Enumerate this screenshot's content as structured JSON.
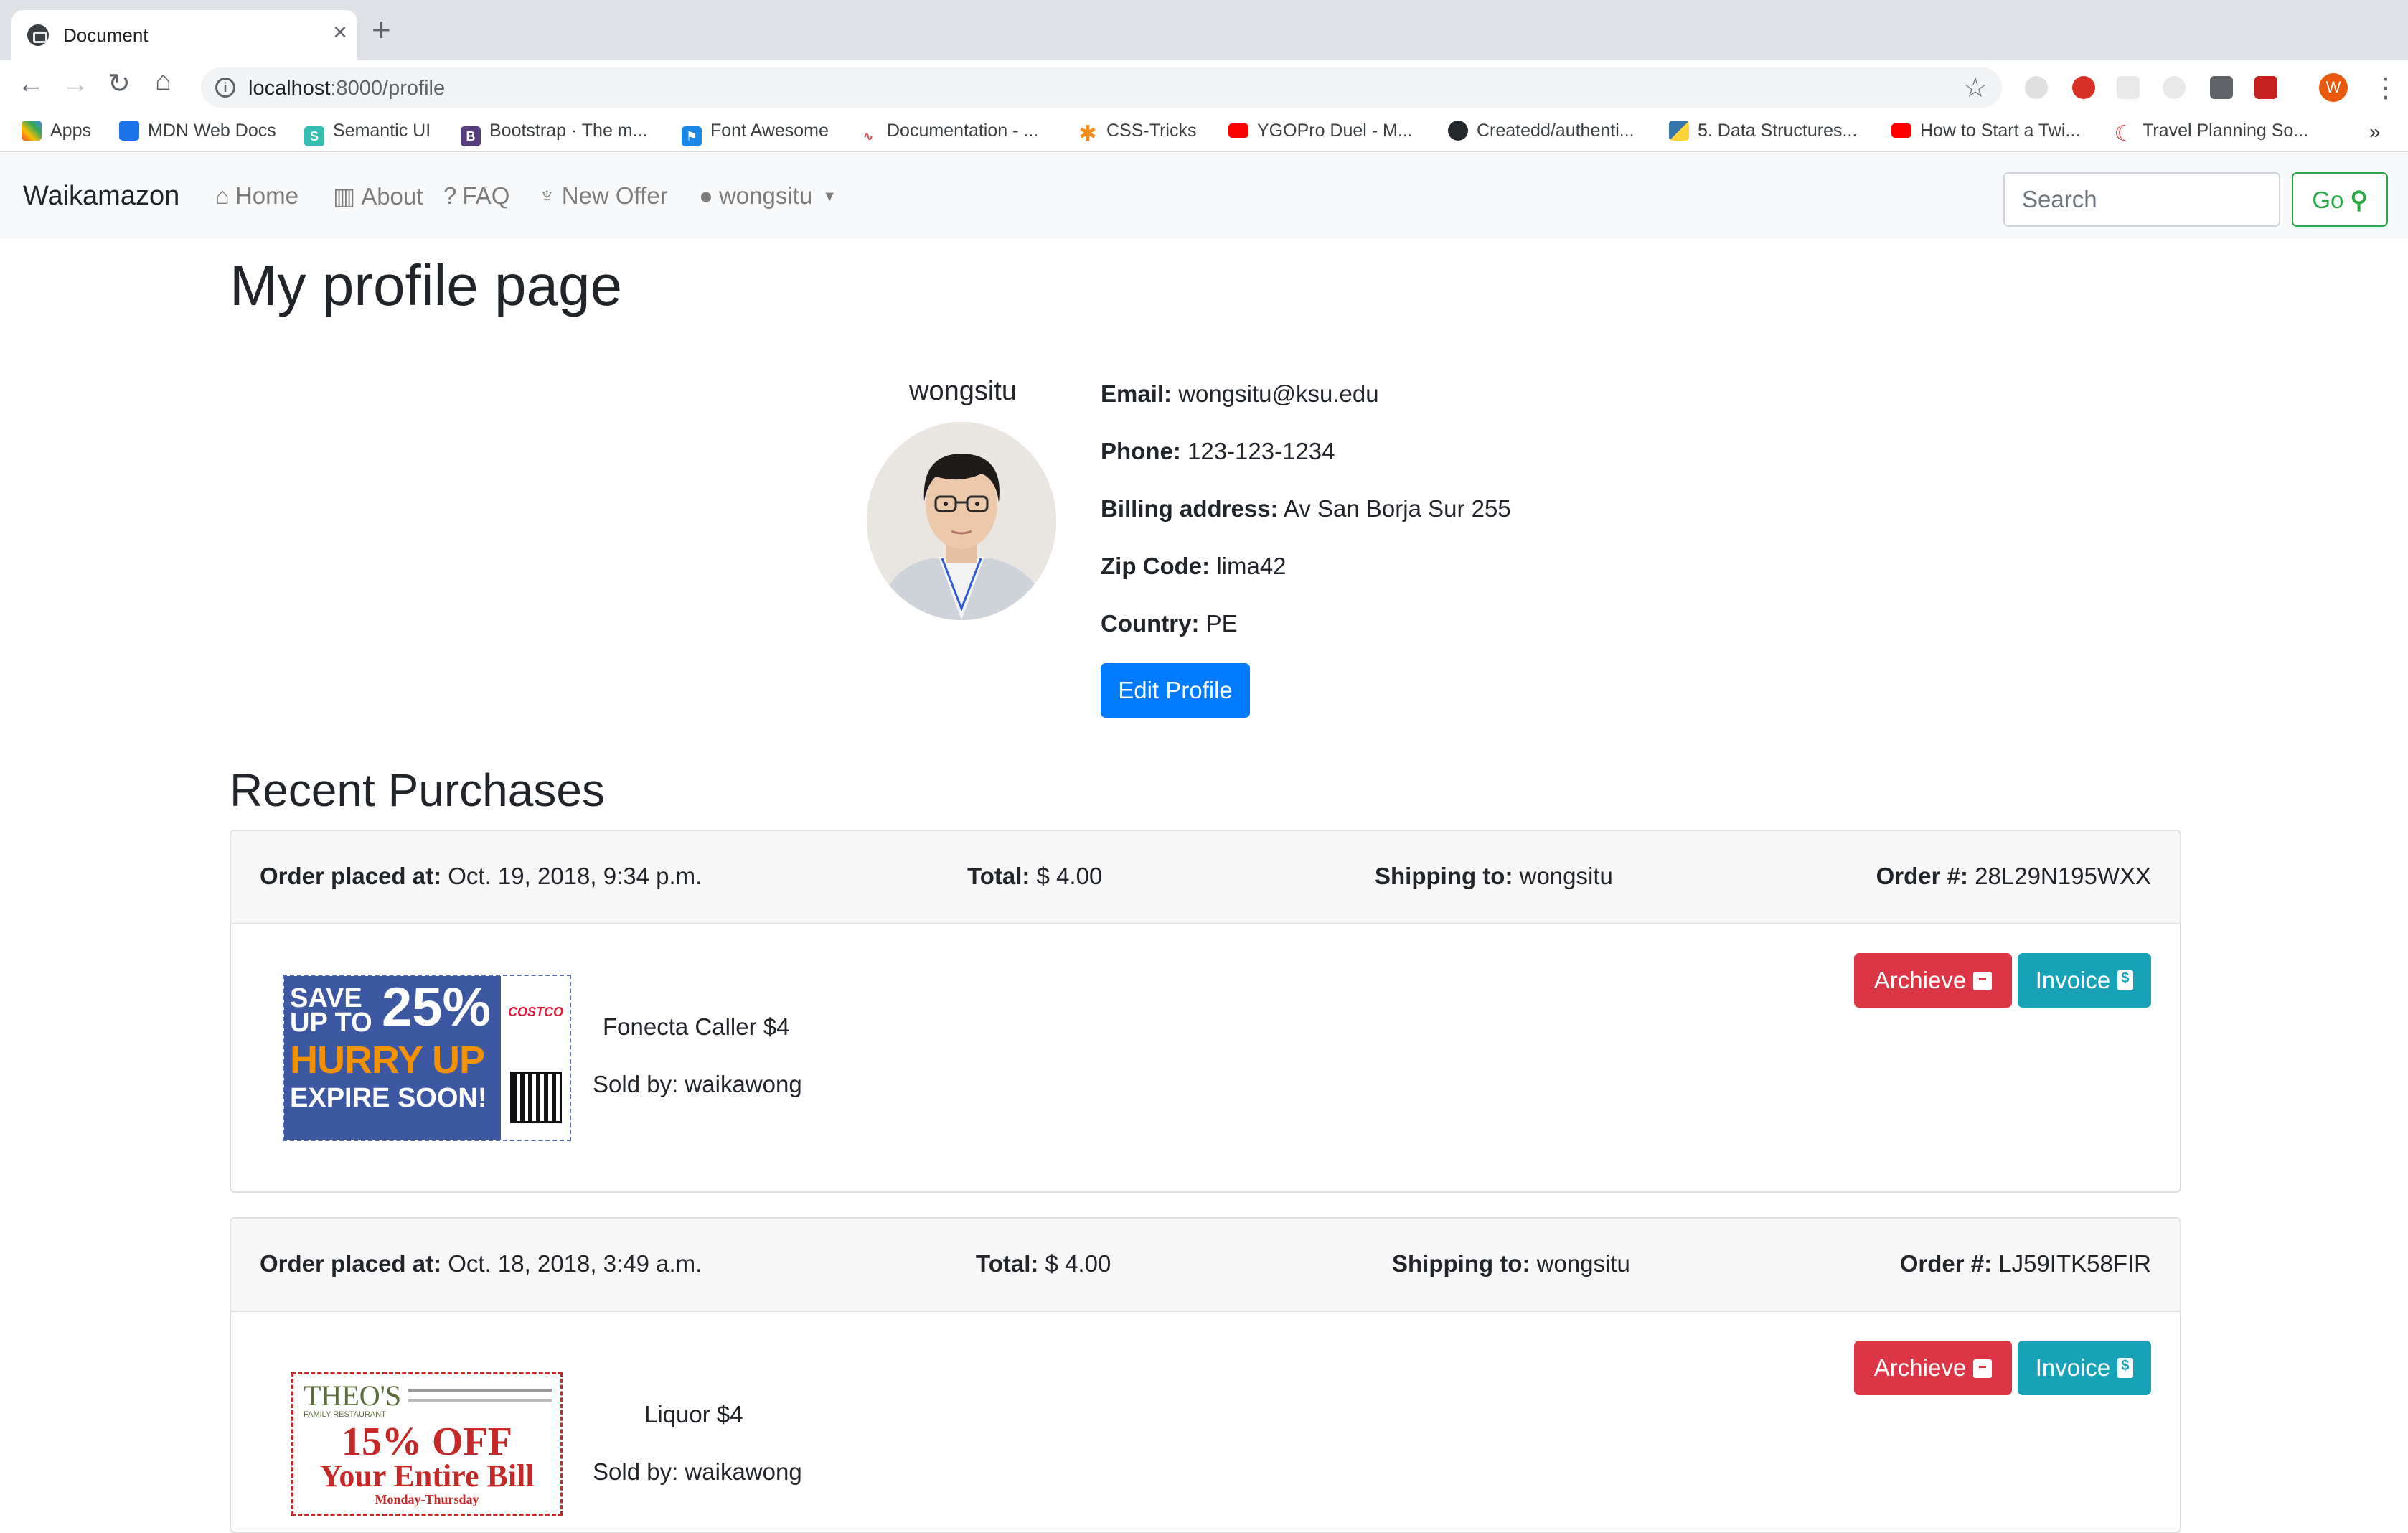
{
  "browser": {
    "tab_title": "Document",
    "url_host": "localhost",
    "url_path": ":8000/profile",
    "profile_initial": "W",
    "bookmarks": [
      "Apps",
      "MDN Web Docs",
      "Semantic UI",
      "Bootstrap · The m...",
      "Font Awesome",
      "Documentation - ...",
      "CSS-Tricks",
      "YGOPro Duel - M...",
      "Createdd/authenti...",
      "5. Data Structures...",
      "How to Start a Twi...",
      "Travel Planning So..."
    ],
    "more_bookmarks": "»"
  },
  "navbar": {
    "brand": "Waikamazon",
    "home": "Home",
    "about": "About",
    "faq": "FAQ",
    "new_offer": "New Offer",
    "user": "wongsitu",
    "search_placeholder": "Search",
    "go_label": "Go"
  },
  "profile": {
    "page_title": "My profile page",
    "username": "wongsitu",
    "email_label": "Email:",
    "email": "wongsitu@ksu.edu",
    "phone_label": "Phone:",
    "phone": "123-123-1234",
    "billing_label": "Billing address:",
    "billing": "Av San Borja Sur 255",
    "zip_label": "Zip Code:",
    "zip": "lima42",
    "country_label": "Country:",
    "country": "PE",
    "edit_label": "Edit Profile"
  },
  "purchases": {
    "title": "Recent Purchases",
    "placed_label": "Order placed at:",
    "total_label": "Total:",
    "shipping_label": "Shipping to:",
    "order_label": "Order #:",
    "sold_label": "Sold by:",
    "archive_label": "Archieve",
    "invoice_label": "Invoice",
    "orders": [
      {
        "placed": "Oct. 19, 2018, 9:34 p.m.",
        "total": "$ 4.00",
        "shipping": "wongsitu",
        "order_no": "28L29N195WXX",
        "product": "Fonecta Caller $4",
        "seller": "waikawong",
        "coupon": {
          "line1": "SAVE",
          "line2": "UP TO",
          "pct": "25%",
          "line3": "HURRY UP",
          "line4": "EXPIRE SOON!",
          "brand": "COSTCO"
        }
      },
      {
        "placed": "Oct. 18, 2018, 3:49 a.m.",
        "total": "$ 4.00",
        "shipping": "wongsitu",
        "order_no": "LJ59ITK58FIR",
        "product": "Liquor $4",
        "seller": "waikawong",
        "coupon": {
          "brand": "THEO'S",
          "sub": "FAMILY RESTAURANT",
          "line1": "15% OFF",
          "line2": "Your Entire Bill",
          "line3": "Monday-Thursday"
        }
      }
    ]
  },
  "colors": {
    "primary": "#007bff",
    "danger": "#dc3545",
    "info": "#17a2b8",
    "success": "#28a745"
  }
}
